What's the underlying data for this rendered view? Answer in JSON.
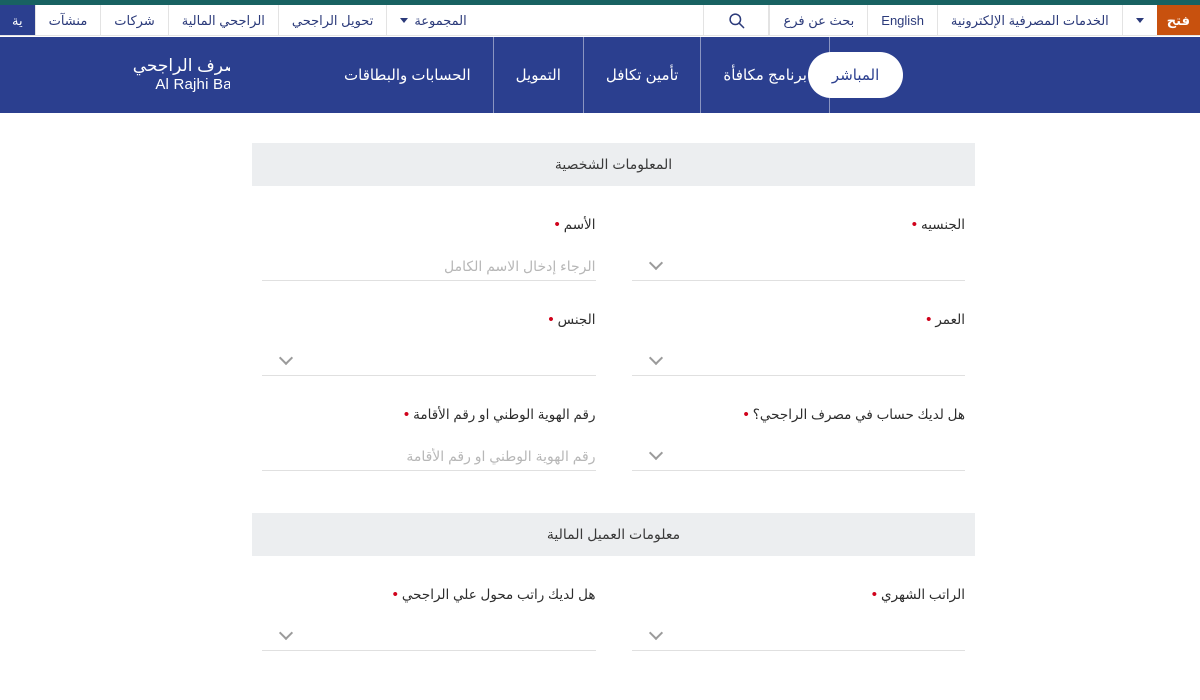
{
  "colors": {
    "teal_strip": "#186262",
    "nav_blue": "#2b3f8f",
    "accent_orange": "#c8510e",
    "required_red": "#d0021b",
    "section_header_bg": "#eceef0"
  },
  "topbar": {
    "promo_button_label": "فتح",
    "ebanking_label": "الخدمات المصرفية الإلكترونية",
    "language_label": "English",
    "branch_search_label": "بحث عن فرع",
    "search_icon": "search-icon",
    "group_label": "المجموعة",
    "group_caret_icon": "chevron-down-icon",
    "nav_links": [
      "تحويل الراجحي",
      "الراجحي المالية",
      "شركات",
      "منشآت"
    ],
    "active_item_label": "ية"
  },
  "mainnav": {
    "logo_ar": "مصرف الراجحي",
    "logo_en": "Al Rajhi Bank",
    "items": [
      {
        "label": "الحسابات والبطاقات",
        "active": false
      },
      {
        "label": "التمويل",
        "active": false
      },
      {
        "label": "تأمين تكافل",
        "active": false
      },
      {
        "label": "برنامج مكافأة",
        "active": false
      },
      {
        "label": "المباشر",
        "active": true
      }
    ]
  },
  "form": {
    "sections": [
      {
        "title": "المعلومات الشخصية",
        "rows": [
          [
            {
              "name": "full-name",
              "label": "الأسم",
              "required": true,
              "type": "text",
              "placeholder": "الرجاء إدخال الاسم الكامل",
              "value": ""
            },
            {
              "name": "nationality",
              "label": "الجنسيه",
              "required": true,
              "type": "select",
              "value": ""
            }
          ],
          [
            {
              "name": "gender",
              "label": "الجنس",
              "required": true,
              "type": "select",
              "value": ""
            },
            {
              "name": "age",
              "label": "العمر",
              "required": true,
              "type": "select",
              "value": ""
            }
          ],
          [
            {
              "name": "national-id",
              "label": "رقم الهوية الوطني او رقم الأقامة",
              "required": true,
              "type": "text",
              "placeholder": "رقم الهوية الوطني او رقم الأقامة",
              "value": ""
            },
            {
              "name": "has-rajhi-account",
              "label": "هل لديك حساب في مصرف الراجحي؟",
              "required": true,
              "type": "select",
              "value": ""
            }
          ]
        ]
      },
      {
        "title": "معلومات العميل المالية",
        "rows": [
          [
            {
              "name": "salary-transferred-to-rajhi",
              "label": "هل لديك راتب محول علي الراجحي",
              "required": true,
              "type": "select",
              "value": ""
            },
            {
              "name": "monthly-salary",
              "label": "الراتب الشهري",
              "required": true,
              "type": "select",
              "value": ""
            }
          ]
        ]
      }
    ]
  }
}
